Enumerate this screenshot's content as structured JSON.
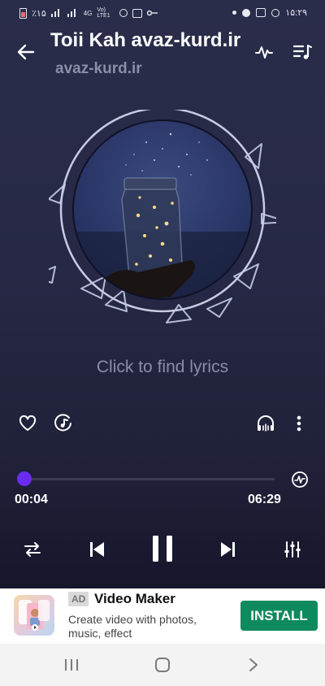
{
  "status_bar": {
    "left_text": "٪۱۵",
    "network": "4G",
    "lte": "Vo) LTE1",
    "time": "۱۵:۲۹"
  },
  "header": {
    "title": "Toii Kah avaz-kurd.ir",
    "subtitle": "avaz-kurd.ir",
    "icons": [
      "back-arrow-icon",
      "waveform-icon",
      "playlist-icon"
    ]
  },
  "lyrics": {
    "prompt": "Click to find lyrics"
  },
  "actions": {
    "left": [
      "heart-icon",
      "disc-note-icon"
    ],
    "right": [
      "headphones-eq-icon",
      "more-vert-icon"
    ]
  },
  "progress": {
    "current": "00:04",
    "total": "06:29",
    "fraction": 0.01
  },
  "controls": [
    "repeat-icon",
    "previous-icon",
    "pause-icon",
    "next-icon",
    "equalizer-icon"
  ],
  "ad": {
    "badge": "AD",
    "title": "Video Maker",
    "description": "Create video with photos, music, effect",
    "button": "INSTALL",
    "button_color": "#0f8a5e"
  },
  "colors": {
    "accent": "#6a2cf0",
    "background": "#262845"
  }
}
